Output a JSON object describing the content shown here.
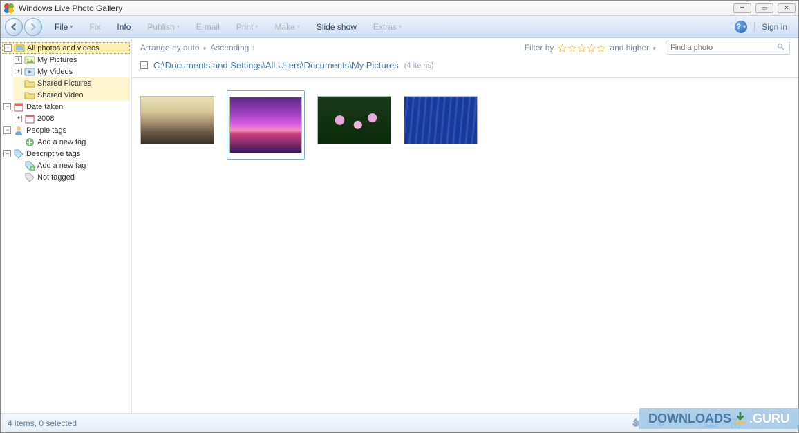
{
  "window": {
    "title": "Windows Live Photo Gallery"
  },
  "toolbar": {
    "menu": [
      {
        "label": "File",
        "dropdown": true,
        "active": true
      },
      {
        "label": "Fix",
        "dropdown": false,
        "active": false
      },
      {
        "label": "Info",
        "dropdown": false,
        "active": true
      },
      {
        "label": "Publish",
        "dropdown": true,
        "active": false
      },
      {
        "label": "E-mail",
        "dropdown": false,
        "active": false
      },
      {
        "label": "Print",
        "dropdown": true,
        "active": false
      },
      {
        "label": "Make",
        "dropdown": true,
        "active": false
      },
      {
        "label": "Slide show",
        "dropdown": false,
        "active": true
      },
      {
        "label": "Extras",
        "dropdown": true,
        "active": false
      }
    ],
    "signin": "Sign in"
  },
  "sortbar": {
    "arrange_label": "Arrange by auto",
    "order_label": "Ascending",
    "filter_label": "Filter by",
    "higher_label": "and higher",
    "search_placeholder": "Find a photo"
  },
  "sidebar": {
    "root": {
      "label": "All photos and videos",
      "selected": true
    },
    "root_children": [
      {
        "label": "My Pictures",
        "icon": "picture",
        "highlight": false
      },
      {
        "label": "My Videos",
        "icon": "video",
        "highlight": false
      },
      {
        "label": "Shared Pictures",
        "icon": "folder",
        "highlight": true
      },
      {
        "label": "Shared Video",
        "icon": "folder",
        "highlight": true
      }
    ],
    "date": {
      "label": "Date taken",
      "child": "2008"
    },
    "people": {
      "label": "People tags",
      "add": "Add a new tag"
    },
    "descriptive": {
      "label": "Descriptive tags",
      "add": "Add a new tag",
      "not": "Not tagged"
    }
  },
  "path": {
    "text": "C:\\Documents and Settings\\All Users\\Documents\\My Pictures",
    "count": "(4 items)"
  },
  "thumbs": [
    {
      "name": "mountain-sunset",
      "selected": false
    },
    {
      "name": "purple-sunset",
      "selected": true
    },
    {
      "name": "lily-pads",
      "selected": false
    },
    {
      "name": "blue-waves",
      "selected": false
    }
  ],
  "status": {
    "text": "4 items, 0 selected"
  },
  "watermark": {
    "a": "DOWNLOADS",
    "b": ".GURU"
  }
}
